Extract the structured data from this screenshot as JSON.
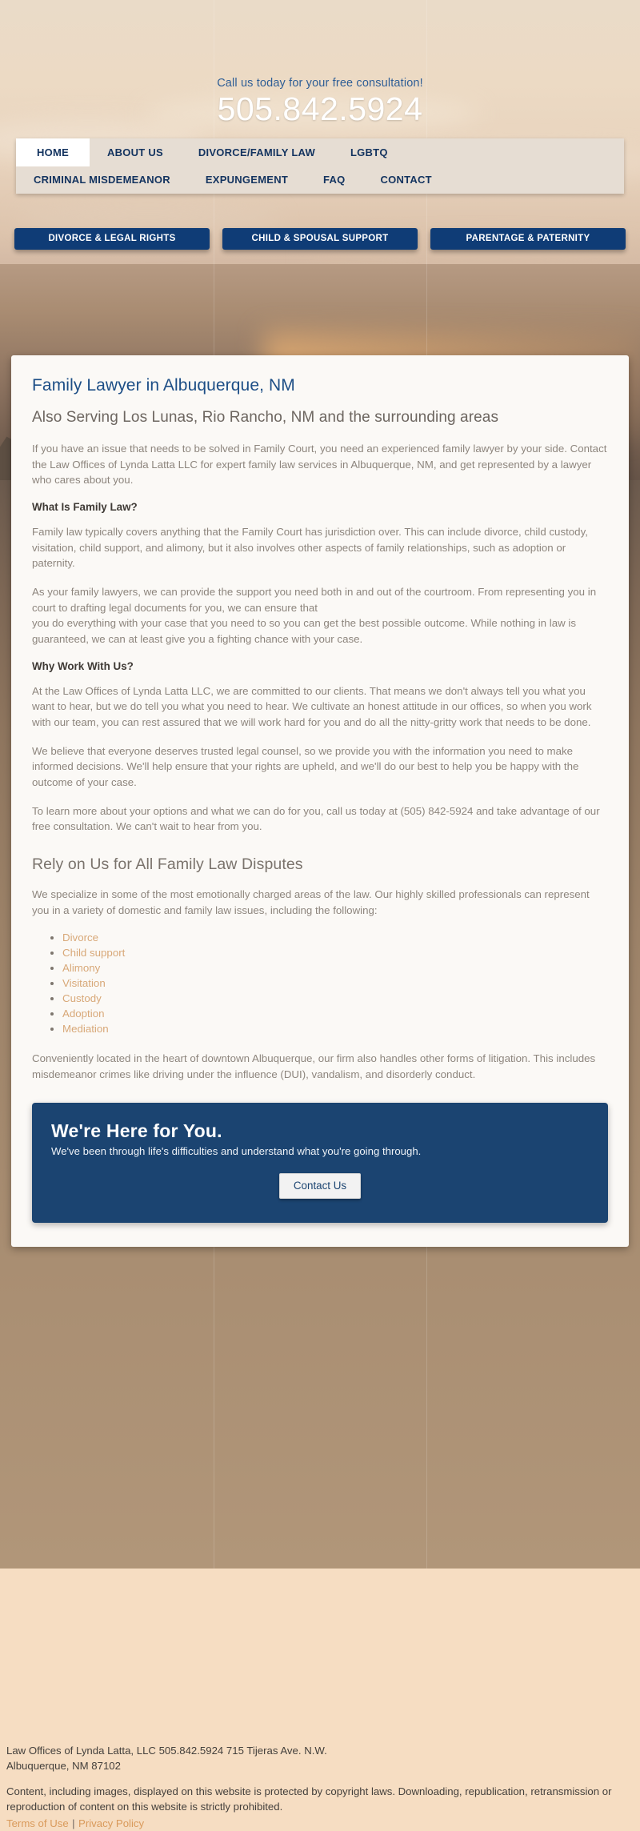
{
  "header": {
    "tagline": "Call us today for your free consultation!",
    "phone": "505.842.5924",
    "tagline_color": "#2e5e96"
  },
  "nav": {
    "row1": [
      {
        "label": "HOME",
        "active": true
      },
      {
        "label": "ABOUT US",
        "active": false
      },
      {
        "label": "DIVORCE/FAMILY LAW",
        "active": false
      },
      {
        "label": "LGBTQ",
        "active": false
      }
    ],
    "row2": [
      {
        "label": "CRIMINAL MISDEMEANOR",
        "active": false
      },
      {
        "label": "EXPUNGEMENT",
        "active": false
      },
      {
        "label": "FAQ",
        "active": false
      },
      {
        "label": "CONTACT",
        "active": false
      }
    ]
  },
  "cta_buttons": [
    {
      "label": "DIVORCE & LEGAL RIGHTS"
    },
    {
      "label": "CHILD & SPOUSAL SUPPORT"
    },
    {
      "label": "PARENTAGE & PATERNITY"
    }
  ],
  "main": {
    "title": "Family Lawyer in Albuquerque, NM",
    "subtitle": "Also Serving Los Lunas, Rio Rancho, NM and the surrounding areas",
    "intro": "If you have an issue that needs to be solved in Family Court, you need an experienced family lawyer by your side. Contact the Law Offices of Lynda Latta LLC for expert family law services in Albuquerque, NM, and get represented by a lawyer who cares about you.",
    "heading_family_law": "What Is Family Law?",
    "p_family_law_1": "Family law typically covers anything that the Family Court has jurisdiction over. This can include divorce, child custody, visitation, child support, and alimony, but it also involves other aspects of family relationships, such as adoption or paternity.",
    "p_family_law_2": "As your family lawyers, we can provide the support you need both in and out of the courtroom. From representing you in court to drafting legal documents for you, we can ensure that\nyou do everything with your case that you need to so you can get the best possible outcome. While nothing in law is guaranteed, we can at least give you a fighting chance with your case.",
    "heading_why_work": "Why Work With Us?",
    "p_why_1": "At the Law Offices of Lynda Latta LLC, we are committed to our clients. That means we don't always tell you what you want to hear, but we do tell you what you need to hear. We cultivate an honest attitude in our offices, so when you work with our team, you can rest assured that we will work hard for you and do all the nitty-gritty work that needs to be done.",
    "p_why_2": "We believe that everyone deserves trusted legal counsel, so we provide you with the information you need to make informed decisions. We'll help ensure that your rights are upheld, and we'll do our best to help you be happy with the outcome of your case.",
    "p_why_3": "To learn more about your options and what we can do for you, call us today at (505) 842-5924 and take advantage of our free consultation. We can't wait to hear from you.",
    "heading_rely": "Rely on Us for All Family Law Disputes",
    "p_rely": "We specialize in some of the most emotionally charged areas of the law. Our highly skilled professionals can represent you in a variety of domestic and family law issues, including the following:",
    "services": [
      "Divorce",
      "Child support",
      "Alimony",
      "Visitation",
      "Custody",
      "Adoption",
      "Mediation"
    ],
    "p_closing": "Conveniently located in the heart of downtown Albuquerque, our firm also handles other forms of litigation. This includes\nmisdemeanor crimes like driving under the influence (DUI), vandalism, and disorderly conduct."
  },
  "promo": {
    "title": "We're Here for You.",
    "subtitle": "We've been through life's difficulties and understand what you're going through.",
    "button_label": "Contact Us",
    "background_color": "#1b4471"
  },
  "footer": {
    "address": "Law Offices of Lynda Latta, LLC 505.842.5924 715 Tijeras Ave. N.W.\nAlbuquerque, NM 87102",
    "copyright": "Content, including images, displayed on this website is protected by copyright laws. Downloading, republication, retransmission or reproduction of content on this website is strictly prohibited.",
    "terms_label": "Terms of Use",
    "separator": "|",
    "privacy_label": "Privacy Policy",
    "link_color": "#d99a5b"
  },
  "theme": {
    "page_background": "#f6ddc2",
    "brand_blue": "#0f3c76",
    "title_blue": "#1d4e86",
    "accent_tan": "#d8a878"
  }
}
